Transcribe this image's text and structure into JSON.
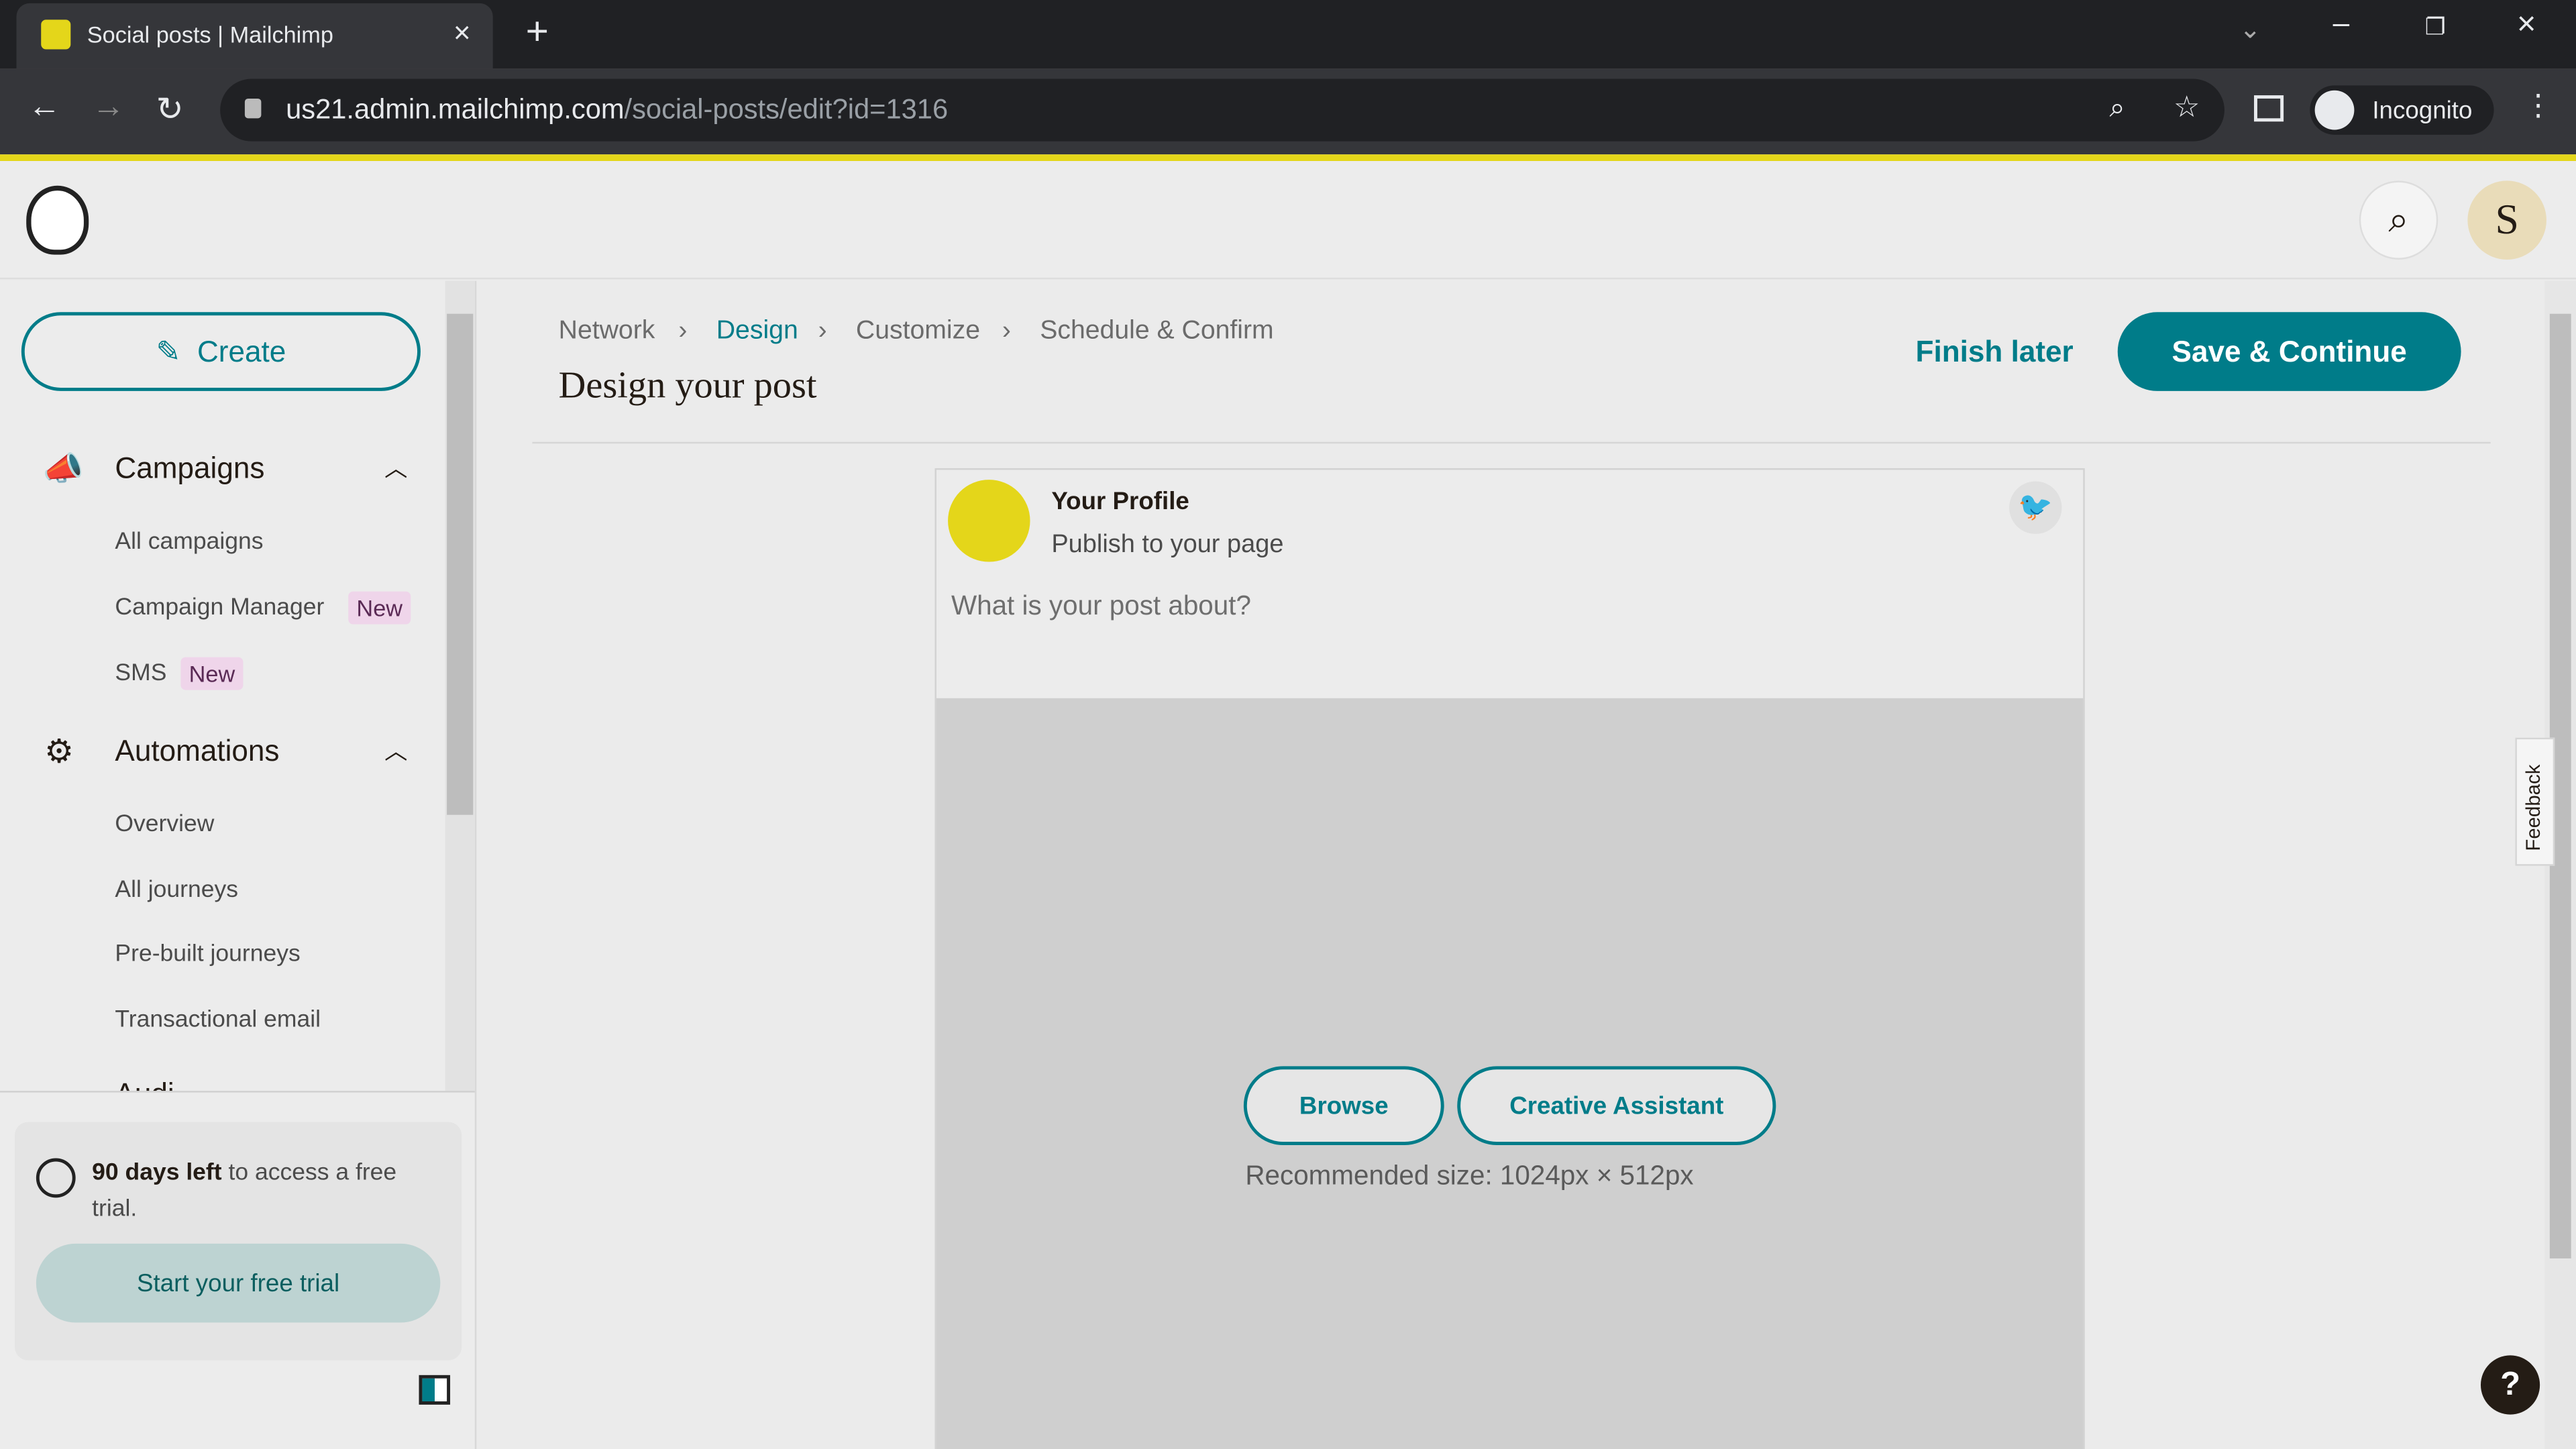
{
  "browser": {
    "tab_title": "Social posts | Mailchimp",
    "url_host": "us21.admin.mailchimp.com",
    "url_path": "/social-posts/edit?id=1316",
    "profile": "Incognito"
  },
  "header": {
    "avatar_initial": "S"
  },
  "sidebar": {
    "create": "Create",
    "campaigns": {
      "label": "Campaigns",
      "items": [
        {
          "label": "All campaigns"
        },
        {
          "label": "Campaign Manager",
          "badge": "New"
        },
        {
          "label": "SMS",
          "badge": "New"
        }
      ]
    },
    "automations": {
      "label": "Automations",
      "items": [
        {
          "label": "Overview"
        },
        {
          "label": "All journeys"
        },
        {
          "label": "Pre-built journeys"
        },
        {
          "label": "Transactional email"
        }
      ]
    },
    "audience_partial": "Audi",
    "trial": {
      "bold": "90 days left",
      "rest": " to access a free trial.",
      "button": "Start your free trial"
    }
  },
  "breadcrumb": [
    "Network",
    "Design",
    "Customize",
    "Schedule & Confirm"
  ],
  "page_title": "Design your post",
  "actions": {
    "finish_later": "Finish later",
    "save_continue": "Save & Continue"
  },
  "post": {
    "profile_name": "Your Profile",
    "profile_sub": "Publish to your page",
    "placeholder": "What is your post about?",
    "browse": "Browse",
    "creative_assistant": "Creative Assistant",
    "recommended": "Recommended size: 1024px × 512px",
    "network_icon": "twitter-icon"
  },
  "feedback": "Feedback",
  "colors": {
    "accent": "#007c89",
    "highlight": "#e4d61a"
  }
}
